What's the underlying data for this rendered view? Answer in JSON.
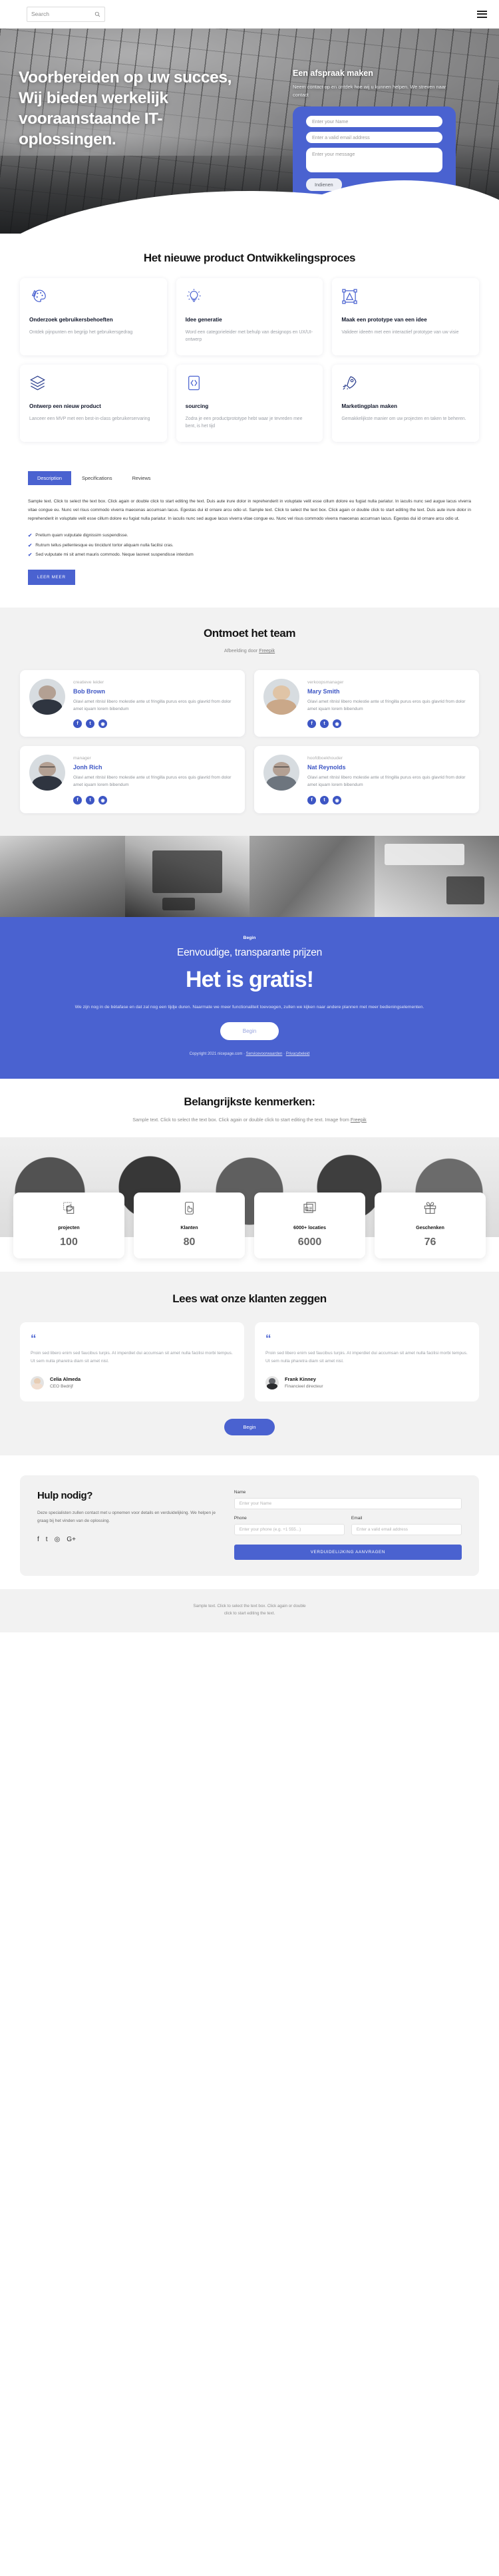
{
  "topbar": {
    "search_placeholder": "Search",
    "search_icon": "search-icon",
    "menu_icon": "hamburger-menu-icon"
  },
  "hero": {
    "title": "Voorbereiden op uw succes, Wij bieden werkelijk vooraanstaande IT-oplossingen.",
    "form_title": "Een afspraak maken",
    "form_text": "Neem contact op en ontdek hoe wij u kunnen helpen. We streven naar contact",
    "name_placeholder": "Enter your Name",
    "email_placeholder": "Enter a valid email address",
    "message_placeholder": "Enter your message",
    "submit_label": "Indienen",
    "accent": "#4a62d0"
  },
  "process": {
    "title": "Het nieuwe product Ontwikkelingsproces",
    "cards": [
      {
        "icon": "palette-brush-icon",
        "title": "Onderzoek gebruikersbehoeften",
        "text": "Ontdek pijnpunten en begrijp het gebruikersgedrag"
      },
      {
        "icon": "lightbulb-icon",
        "title": "Idee generatie",
        "text": "Word een categorieleider met behulp van designops en UX/UI-ontwerp"
      },
      {
        "icon": "prototype-frame-icon",
        "title": "Maak een prototype van een idee",
        "text": "Valideer ideeën met een interactief prototype van uw visie"
      },
      {
        "icon": "layers-icon",
        "title": "Ontwerp een nieuw product",
        "text": "Lanceer een MVP met een best-in-class gebruikerservaring"
      },
      {
        "icon": "code-brackets-icon",
        "title": "sourcing",
        "text": "Zodra je een productprototype hebt waar je tevreden mee bent, is het tijd"
      },
      {
        "icon": "rocket-icon",
        "title": "Marketingplan maken",
        "text": "Gemakkelijkste manier om uw projecten en taken te beheren."
      }
    ]
  },
  "tabs": {
    "items": [
      "Description",
      "Specifications",
      "Reviews"
    ],
    "active": "Description",
    "body": "Sample text. Click to select the text box. Click again or double click to start editing the text. Duis aute irure dolor in reprehenderit in voluptate velit esse cillum dolore eu fugiat nulla pariatur. In iaculis nunc sed augue lacus viverra vitae congue eu. Nunc vel risus commodo viverra maecenas accumsan lacus. Egestas dui id ornare arcu odio ut. Sample text. Click to select the text box. Click again or double click to start editing the text. Duis aute irure dolor in reprehenderit in voluptate velit esse cillum dolore eu fugiat nulla pariatur. In iaculis nunc sed augue lacus viverra vitae congue eu. Nunc vel risus commodo viverra maecenas accumsan lacus. Egestas dui id ornare arcu odio ut.",
    "bullets": [
      "Pretium quam vulputate dignissim suspendisse.",
      "Rutrum tellus pellentesque eu tincidunt tortor aliquam nulla facilisi cras.",
      "Sed vulputate mi sit amet mauris commodo. Neque laoreet suspendisse interdum"
    ],
    "cta": "LEER MEER"
  },
  "team": {
    "title": "Ontmoet het team",
    "credit_prefix": "Afbeelding door ",
    "credit_link": "Freepik",
    "bio": "Glavi amet ritnisl libero molestie ante ut fringilla purus eros quis glavrid from dolor amet iquam lorem bibendum",
    "members": [
      {
        "role": "creatieve leider",
        "name": "Bob Brown"
      },
      {
        "role": "verkoopsmanager",
        "name": "Mary Smith"
      },
      {
        "role": "manager",
        "name": "Jonh Rich"
      },
      {
        "role": "hoofdboekhouder",
        "name": "Nat Reynolds"
      }
    ],
    "socials": [
      "facebook-icon",
      "twitter-icon",
      "instagram-icon"
    ]
  },
  "pricing": {
    "eyebrow": "Begin",
    "heading": "Eenvoudige, transparante prijzen",
    "big": "Het is gratis!",
    "text": "We zijn nog in de bètafase en dat zal nog een tijdje duren. Naarmate we meer functionaliteit toevoegen, zullen we kijken naar andere plannen met meer bedieningselementen.",
    "cta": "Begin",
    "copyright": "Copyright 2021 nicepage.com · ",
    "terms_link": "Servicevoorwaarden",
    "copyright_sep": " · ",
    "privacy_link": "Privacybeleid",
    "bg": "#4a62d0"
  },
  "features": {
    "title": "Belangrijkste kenmerken:",
    "subtitle": "Sample text. Click to select the text box. Click again or double click to start editing the text. Image from ",
    "subtitle_link": "Freepik",
    "counters": [
      {
        "icon": "design-select-icon",
        "label": "projecten",
        "value": "100"
      },
      {
        "icon": "mobile-tap-icon",
        "label": "Klanten",
        "value": "80"
      },
      {
        "icon": "news-cards-icon",
        "label": "6000+ locaties",
        "value": "6000"
      },
      {
        "icon": "gift-icon",
        "label": "Geschenken",
        "value": "76"
      }
    ]
  },
  "testimonials": {
    "title": "Lees wat onze klanten zeggen",
    "quote_icon": "quote-mark-icon",
    "items": [
      {
        "text": "Proin sed libero enim sed faucibus turpis. At imperdiet dui accumsan sit amet nulla facilisi morbi tempus. Ut sem nulla pharetra diam sit amet nisl.",
        "name": "Celia Almeda",
        "role": "CEO Bedrijf"
      },
      {
        "text": "Proin sed libero enim sed faucibus turpis. At imperdiet dui accumsan sit amet nulla facilisi morbi tempus. Ut sem nulla pharetra diam sit amet nisl.",
        "name": "Frank Kinney",
        "role": "Financieel directeur"
      }
    ],
    "cta": "Begin"
  },
  "contact": {
    "title": "Hulp nodig?",
    "text": "Deze specialisten zullen contact met u opnemen voor details en verduidelijking. We helpen je graag bij het vinden van de oplossing.",
    "socials": [
      "facebook-icon",
      "twitter-icon",
      "instagram-icon",
      "google-plus-icon"
    ],
    "name_label": "Name",
    "name_placeholder": "Enter your Name",
    "phone_label": "Phone",
    "phone_placeholder": "Enter your phone (e.g. +1 555...)",
    "email_label": "Email",
    "email_placeholder": "Enter a valid email address",
    "submit_label": "VERDUIDELIJKING AANVRAGEN"
  },
  "footer": {
    "line1": "Sample text. Click to select the text box. Click again or double",
    "line2": "click to start editing the text."
  }
}
